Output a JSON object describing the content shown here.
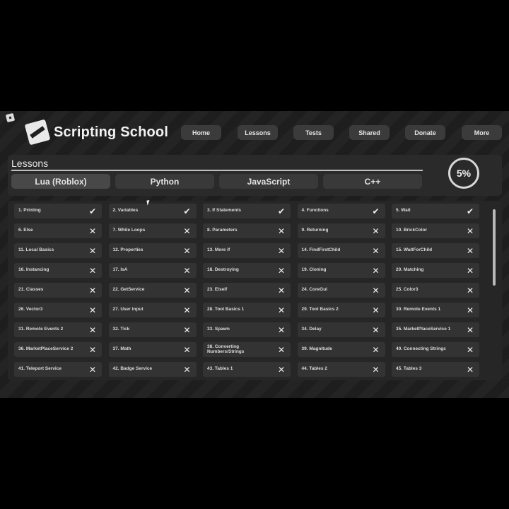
{
  "app": {
    "title": "Scripting School",
    "logo_icon": "roblox-studio-logo-icon"
  },
  "nav": [
    {
      "label": "Home"
    },
    {
      "label": "Lessons"
    },
    {
      "label": "Tests"
    },
    {
      "label": "Shared"
    },
    {
      "label": "Donate"
    },
    {
      "label": "More"
    }
  ],
  "lessons_panel": {
    "title": "Lessons",
    "progress": "5%",
    "progress_value": 5,
    "tabs": [
      {
        "label": "Lua (Roblox)",
        "active": true
      },
      {
        "label": "Python",
        "active": false
      },
      {
        "label": "JavaScript",
        "active": false
      },
      {
        "label": "C++",
        "active": false
      }
    ]
  },
  "lessons": [
    {
      "label": "1. Printing",
      "done": true
    },
    {
      "label": "2. Variables",
      "done": true
    },
    {
      "label": "3. If Statements",
      "done": true
    },
    {
      "label": "4. Functions",
      "done": true
    },
    {
      "label": "5. Wait",
      "done": true
    },
    {
      "label": "6. Else",
      "done": false
    },
    {
      "label": "7. While Loops",
      "done": false
    },
    {
      "label": "8. Parameters",
      "done": false
    },
    {
      "label": "9. Returning",
      "done": false
    },
    {
      "label": "10. BrickColor",
      "done": false
    },
    {
      "label": "11. Local Basics",
      "done": false
    },
    {
      "label": "12. Properties",
      "done": false
    },
    {
      "label": "13. More if",
      "done": false
    },
    {
      "label": "14. FindFirstChild",
      "done": false
    },
    {
      "label": "15. WaitForChild",
      "done": false
    },
    {
      "label": "16. Instancing",
      "done": false
    },
    {
      "label": "17. IsA",
      "done": false
    },
    {
      "label": "18. Destroying",
      "done": false
    },
    {
      "label": "19. Cloning",
      "done": false
    },
    {
      "label": "20. Matching",
      "done": false
    },
    {
      "label": "21. Classes",
      "done": false
    },
    {
      "label": "22. GetService",
      "done": false
    },
    {
      "label": "23. Elseif",
      "done": false
    },
    {
      "label": "24. CoreGui",
      "done": false
    },
    {
      "label": "25. Color3",
      "done": false
    },
    {
      "label": "26. Vector3",
      "done": false
    },
    {
      "label": "27. User input",
      "done": false
    },
    {
      "label": "28. Tool Basics 1",
      "done": false
    },
    {
      "label": "29. Tool Basics 2",
      "done": false
    },
    {
      "label": "30. Remote Events 1",
      "done": false
    },
    {
      "label": "31. Remote Events 2",
      "done": false
    },
    {
      "label": "32. Tick",
      "done": false
    },
    {
      "label": "33. Spawn",
      "done": false
    },
    {
      "label": "34. Delay",
      "done": false
    },
    {
      "label": "35. MarketPlaceService 1",
      "done": false
    },
    {
      "label": "36. MarketPlaceService 2",
      "done": false
    },
    {
      "label": "37. Math",
      "done": false
    },
    {
      "label": "38. Converting Numbers/Strings",
      "done": false
    },
    {
      "label": "39. Magnitude",
      "done": false
    },
    {
      "label": "40. Connecting Strings",
      "done": false
    },
    {
      "label": "41. Teleport Service",
      "done": false
    },
    {
      "label": "42. Badge Service",
      "done": false
    },
    {
      "label": "43. Tables 1",
      "done": false
    },
    {
      "label": "44. Tables 2",
      "done": false
    },
    {
      "label": "45. Tables 3",
      "done": false
    }
  ],
  "icons": {
    "done": "checkmark-icon",
    "not_done": "cross-icon"
  },
  "colors": {
    "background": "#1f1f1f",
    "panel": "#2a2a2a",
    "card": "#333333",
    "text": "#e6e6e6"
  }
}
